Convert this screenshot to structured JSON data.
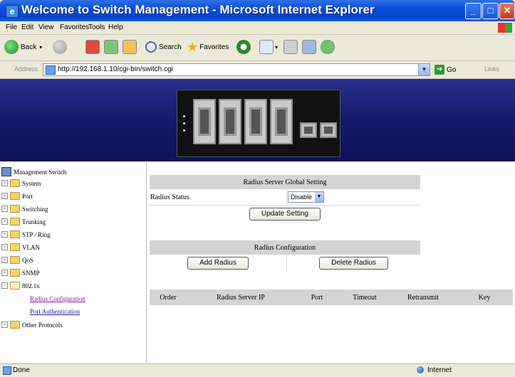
{
  "window": {
    "title": "Welcome to Switch Management - Microsoft Internet Explorer"
  },
  "menu": {
    "items": [
      "File",
      "Edit",
      "View",
      "Favorites",
      "Tools",
      "Help"
    ]
  },
  "toolbar": {
    "back": "Back",
    "search": "Search",
    "favorites": "Favorites"
  },
  "address": {
    "label": "Address",
    "url": "http://192.168.1.10/cgi-bin/switch.cgi",
    "go": "Go",
    "links": "Links"
  },
  "sidebar": {
    "root": "Management Switch",
    "items": [
      "System",
      "Port",
      "Switching",
      "Trunking",
      "STP / Ring",
      "VLAN",
      "QoS",
      "SNMP",
      "802.1x"
    ],
    "sub_items": [
      "Radius Configuration",
      "Port Authentication"
    ],
    "last_item": "Other Protocols"
  },
  "global_setting": {
    "header": "Radius Server Global Setting",
    "status_label": "Radius Status",
    "status_value": "Disable",
    "update_button": "Update Setting"
  },
  "radius_config": {
    "header": "Radius Configuration",
    "add_button": "Add Radius",
    "delete_button": "Delete Radius"
  },
  "server_table": {
    "columns": [
      "Order",
      "Radius Server IP",
      "Port",
      "Timeout",
      "Retransmit",
      "Key"
    ]
  },
  "status": {
    "left": "Done",
    "right": "Internet"
  }
}
